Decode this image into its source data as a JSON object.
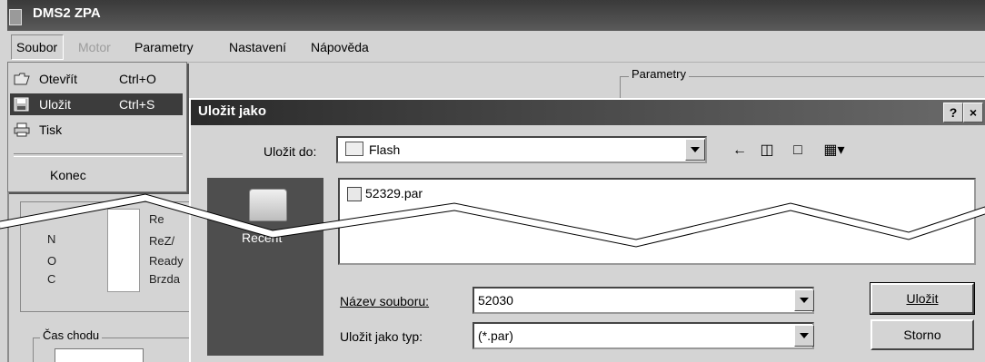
{
  "window": {
    "title": "DMS2 ZPA"
  },
  "menubar": {
    "items": [
      {
        "label": "Soubor",
        "enabled": true
      },
      {
        "label": "Motor",
        "enabled": false
      },
      {
        "label": "Parametry",
        "enabled": true
      },
      {
        "label": "Nastavení",
        "enabled": true
      },
      {
        "label": "Nápověda",
        "enabled": true
      }
    ]
  },
  "file_menu": {
    "items": [
      {
        "label": "Otevřít",
        "shortcut": "Ctrl+O",
        "icon": "open-folder-icon"
      },
      {
        "label": "Uložit",
        "shortcut": "Ctrl+S",
        "icon": "floppy-disk-icon",
        "highlighted": true
      },
      {
        "label": "Tisk",
        "shortcut": "",
        "icon": "printer-icon"
      },
      {
        "label": "Konec",
        "shortcut": ""
      }
    ]
  },
  "background": {
    "parametry_group": "Parametry",
    "status_labels": [
      "Re",
      "ReZ/",
      "Ready",
      "Brzda"
    ],
    "status_codes": [
      "N",
      "O",
      "C"
    ],
    "cas_chodu": "Čas chodu"
  },
  "dialog": {
    "title": "Uložit jako",
    "help_btn": "?",
    "close_btn": "×",
    "save_in_label": "Uložit do:",
    "save_in_value": "Flash",
    "places": [
      {
        "label": "Recent"
      }
    ],
    "files": [
      {
        "name": "52329.par"
      }
    ],
    "filename_label": "Název souboru:",
    "filename_value": "52030",
    "filetype_label": "Uložit jako typ:",
    "filetype_value": "(*.par)",
    "save_btn": "Uložit",
    "cancel_btn": "Storno"
  },
  "colors": {
    "highlight": "#3c3c3c",
    "title_bar": "#2a2a2a",
    "background": "#d4d4d4"
  }
}
